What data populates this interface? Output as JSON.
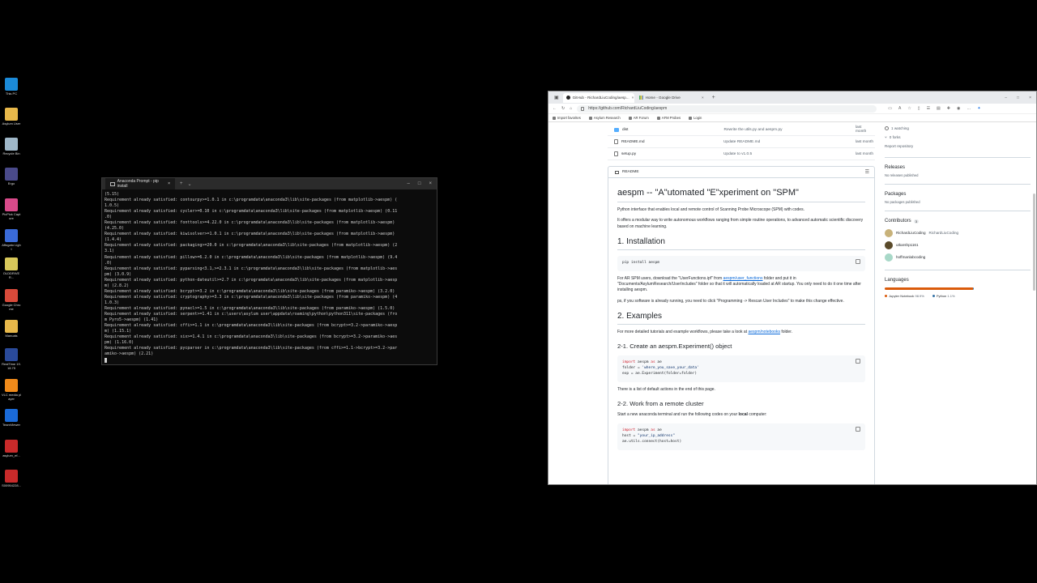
{
  "desktop": {
    "icons": [
      {
        "label": "This PC",
        "color": "#1b8ad8"
      },
      {
        "label": "Asylum User",
        "color": "#e8b84a"
      },
      {
        "label": "Recycle Bin",
        "color": "#9fb7c8"
      },
      {
        "label": "Ergo",
        "color": "#4a4a8a"
      },
      {
        "label": "PicPick Capture",
        "color": "#d94a8a"
      },
      {
        "label": "Affogato Light",
        "color": "#3a6ad8"
      },
      {
        "label": "OLDDRIVER...",
        "color": "#d8c85a"
      },
      {
        "label": "Google Chrome",
        "color": "#d84a3a"
      },
      {
        "label": "Manuals",
        "color": "#e8b84a"
      },
      {
        "label": "RealTime 19.18.75",
        "color": "#2a4a9a"
      },
      {
        "label": "VLC media player",
        "color": "#f08a1a"
      },
      {
        "label": "TeamViewer",
        "color": "#1a6ad8"
      },
      {
        "label": "asylum_ef...",
        "color": "#c82a2a"
      },
      {
        "label": "S00954228...",
        "color": "#c82a2a"
      }
    ]
  },
  "terminal": {
    "tab_title": "Anaconda Prompt - pip install",
    "lines": [
      "(5.15)",
      "Requirement already satisfied: contourpy>=1.0.1 in c:\\programdata\\anaconda3\\lib\\site-packages (from matplotlib->aespm) (",
      "1.0.5)",
      "Requirement already satisfied: cycler>=0.10 in c:\\programdata\\anaconda3\\lib\\site-packages (from matplotlib->aespm) (0.11",
      ".0)",
      "Requirement already satisfied: fonttools>=4.22.0 in c:\\programdata\\anaconda3\\lib\\site-packages (from matplotlib->aespm)",
      "(4.25.0)",
      "Requirement already satisfied: kiwisolver>=1.0.1 in c:\\programdata\\anaconda3\\lib\\site-packages (from matplotlib->aespm)",
      "(1.4.4)",
      "Requirement already satisfied: packaging>=20.0 in c:\\programdata\\anaconda3\\lib\\site-packages (from matplotlib->aespm) (2",
      "3.1)",
      "Requirement already satisfied: pillow>=6.2.0 in c:\\programdata\\anaconda3\\lib\\site-packages (from matplotlib->aespm) (9.4",
      ".0)",
      "Requirement already satisfied: pyparsing<3.1,>=2.3.1 in c:\\programdata\\anaconda3\\lib\\site-packages (from matplotlib->aes",
      "pm) (3.0.9)",
      "Requirement already satisfied: python-dateutil>=2.7 in c:\\programdata\\anaconda3\\lib\\site-packages (from matplotlib->aesp",
      "m) (2.8.2)",
      "Requirement already satisfied: bcrypt>=3.2 in c:\\programdata\\anaconda3\\lib\\site-packages (from paramiko->aespm) (3.2.0)",
      "Requirement already satisfied: cryptography>=3.3 in c:\\programdata\\anaconda3\\lib\\site-packages (from paramiko->aespm) (4",
      "1.0.3)",
      "Requirement already satisfied: pynacl>=1.5 in c:\\programdata\\anaconda3\\lib\\site-packages (from paramiko->aespm) (1.5.0)",
      "Requirement already satisfied: serpent>=1.41 in c:\\users\\asylum user\\appdata\\roaming\\python\\python311\\site-packages (fro",
      "m Pyro5->aespm) (1.41)",
      "Requirement already satisfied: cffi>=1.1 in c:\\programdata\\anaconda3\\lib\\site-packages (from bcrypt>=3.2->paramiko->aesp",
      "m) (1.15.1)",
      "Requirement already satisfied: six>=1.4.1 in c:\\programdata\\anaconda3\\lib\\site-packages (from bcrypt>=3.2->paramiko->aes",
      "pm) (1.16.0)",
      "Requirement already satisfied: pycparser in c:\\programdata\\anaconda3\\lib\\site-packages (from cffi>=1.1->bcrypt>=3.2->par",
      "amiko->aespm) (2.21)"
    ]
  },
  "browser": {
    "tabs": [
      {
        "title": "GitHub - RichardLiuCoding/aesp..."
      },
      {
        "title": "Home - Google Drive"
      }
    ],
    "url": "https://github.com/RichardLiuCoding/aespm",
    "favorites": [
      "Import favorites",
      "Asylum Research",
      "AR Forum",
      "AFM Probes",
      "Login"
    ],
    "files": [
      {
        "name": "dist",
        "message": "Rewrite the utils.py and aespm.py",
        "date": "last month",
        "kind": "folder"
      },
      {
        "name": "README.md",
        "message": "Update README.md",
        "date": "last month",
        "kind": "file"
      },
      {
        "name": "setup.py",
        "message": "Update to v1.0.5",
        "date": "last month",
        "kind": "file"
      }
    ],
    "readme": {
      "header": "README",
      "title": "aespm -- \"A\"utomated \"E\"xperiment on \"SPM\"",
      "intro1": "Python interface that enables local and remote control of Scanning Probe Microscope (SPM) with codes.",
      "intro2": "It offers a modular way to write autonomous workflows ranging from simple routine operations, to advanced automatic scientific discovery based on machine learning.",
      "h_install": "1. Installation",
      "code_install": "pip install aespm",
      "install_p1_a": "For AR SPM users, download the \"UserFunctions.ipf\" from ",
      "install_p1_link": "aespm/user_functions",
      "install_p1_b": " folder and put it in \"Documents/AsylumResearch/UserIncludes\" folder so that it will automatically loaded at AR startup. You only need to do it one time after installing aespm.",
      "install_p2": "ps, if you software is already running, you need to click \"Programming -> Rescan User Includes\" to make this change effective.",
      "h_examples": "2. Examples",
      "examples_p_a": "For more detailed tutorials and example workflows, please take a look at ",
      "examples_p_link": "aespm/notebooks",
      "examples_p_b": " folder.",
      "h_21": "2-1. Create an aespm.Experiment() object",
      "code_21": [
        "import aespm as ae",
        "folder = 'where_you_save_your_data'",
        "exp = ae.Experiment(folder=folder)"
      ],
      "p_21": "There is a list of default actions in the end of this page.",
      "h_22": "2-2. Work from a remote cluster",
      "p_22_a": "Start a new anaconda terminal and run the following codes on your ",
      "p_22_bold": "local",
      "p_22_b": " computer:",
      "code_22": [
        "import aespm as ae",
        "host = \"your_ip_address\"",
        "ae.utils.connect(host=host)"
      ]
    },
    "sidebar": {
      "watching": "1 watching",
      "forks": "0 forks",
      "report": "Report repository",
      "releases_title": "Releases",
      "releases_text": "No releases published",
      "packages_title": "Packages",
      "packages_text": "No packages published",
      "contributors_title": "Contributors",
      "contributors_count": "3",
      "contributors": [
        {
          "name": "RichardLiuCoding",
          "handle": "RichardLiuCoding",
          "color": "#c8b27a"
        },
        {
          "name": "utkarshp1161",
          "handle": "",
          "color": "#5a4a2a"
        },
        {
          "name": "hoffmanlabcoding",
          "handle": "",
          "color": "#a8d8c8"
        }
      ],
      "languages_title": "Languages",
      "languages": [
        {
          "name": "Jupyter Notebook",
          "pct": "98.9%",
          "share": 98.9,
          "color": "#da5b0b"
        },
        {
          "name": "Python",
          "pct": "1.1%",
          "share": 1.1,
          "color": "#3572a5"
        }
      ]
    }
  }
}
